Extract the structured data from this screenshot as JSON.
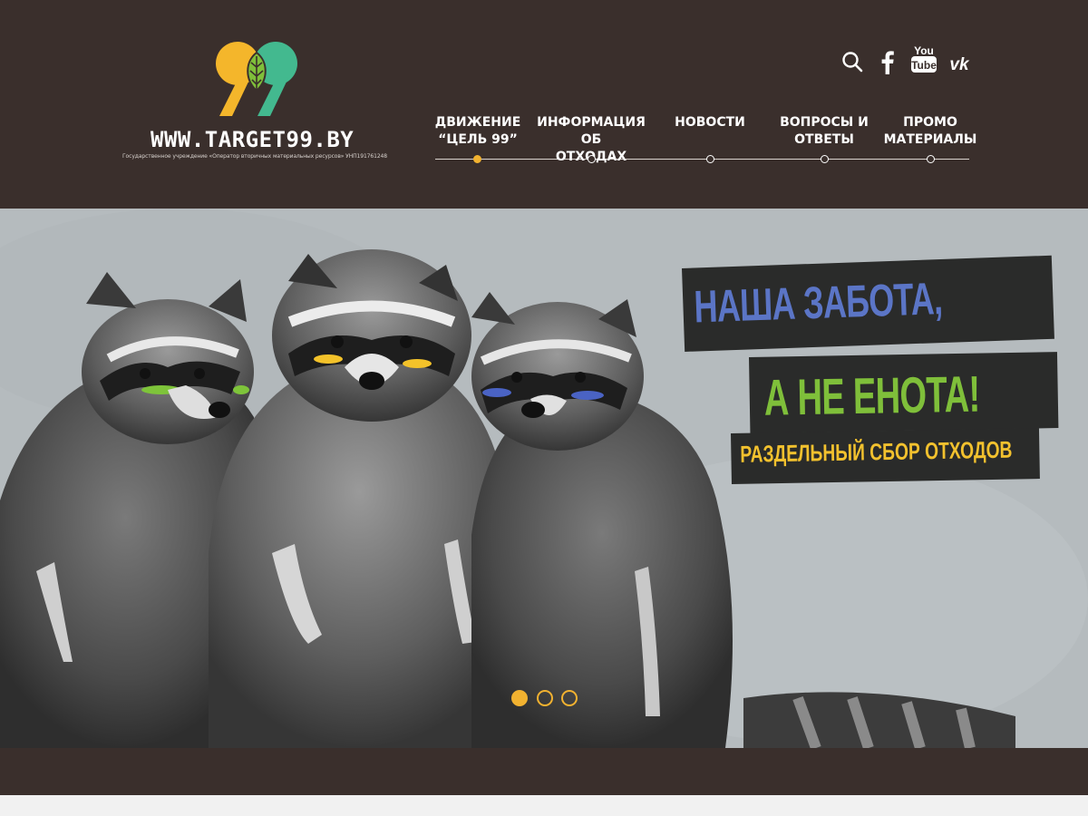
{
  "header": {
    "logo": {
      "mark": "99",
      "url_text": "WWW.TARGET99.BY",
      "subtitle": "Государственное учреждение «Оператор вторичных материальных ресурсов» УНП191761248"
    },
    "socials": [
      {
        "name": "search-icon"
      },
      {
        "name": "facebook-icon"
      },
      {
        "name": "youtube-icon",
        "label_top": "You",
        "label_bottom": "Tube"
      },
      {
        "name": "vk-icon",
        "label": "vk"
      }
    ],
    "nav": {
      "items": [
        {
          "label": "ДВИЖЕНИЕ\n“ЦЕЛЬ 99”",
          "active": true
        },
        {
          "label": "ИНФОРМАЦИЯ ОБ\nОТХОДАХ",
          "active": false
        },
        {
          "label": "НОВОСТИ",
          "active": false
        },
        {
          "label": "ВОПРОСЫ И\nОТВЕТЫ",
          "active": false
        },
        {
          "label": "ПРОМО\nМАТЕРИАЛЫ",
          "active": false
        }
      ]
    }
  },
  "hero": {
    "slogan": {
      "line1": "НАША ЗАБОТА,",
      "line2": "А НЕ ЕНОТА!",
      "line3": "РАЗДЕЛЬНЫЙ СБОР ОТХОДОВ"
    },
    "slides": [
      {
        "active": true
      },
      {
        "active": false
      },
      {
        "active": false
      }
    ]
  },
  "colors": {
    "header_bg": "#3a2f2c",
    "accent_yellow": "#f2b230",
    "logo_green": "#3fb58a",
    "slogan_blue": "#5b75c6",
    "slogan_green": "#7fbf3a"
  }
}
